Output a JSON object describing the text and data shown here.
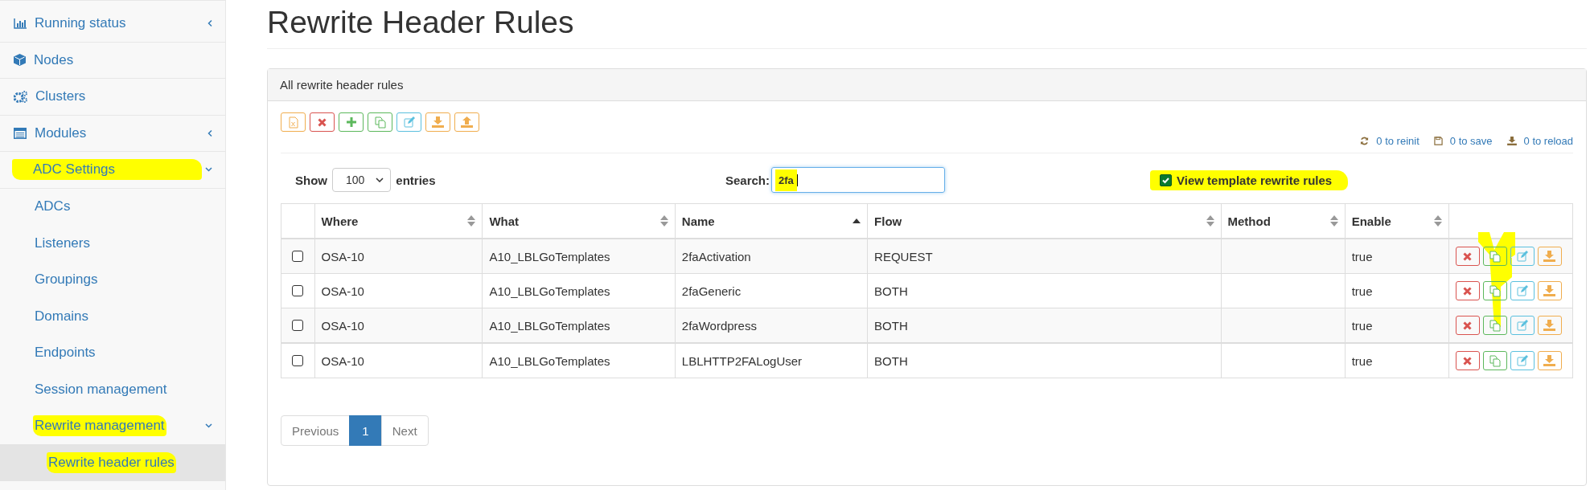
{
  "sidebar": {
    "items": [
      {
        "label": "Running status",
        "expanded": false,
        "highlighted": false,
        "selected": false
      },
      {
        "label": "Nodes",
        "highlighted": false,
        "selected": false
      },
      {
        "label": "Clusters",
        "highlighted": false,
        "selected": false
      },
      {
        "label": "Modules",
        "expanded": false,
        "highlighted": false,
        "selected": false
      },
      {
        "label": "ADC Settings",
        "expanded": true,
        "highlighted": true,
        "selected": false,
        "children": [
          {
            "label": "ADCs",
            "highlighted": false,
            "selected": false
          },
          {
            "label": "Listeners",
            "highlighted": false,
            "selected": false
          },
          {
            "label": "Groupings",
            "highlighted": false,
            "selected": false
          },
          {
            "label": "Domains",
            "highlighted": false,
            "selected": false
          },
          {
            "label": "Endpoints",
            "highlighted": false,
            "selected": false
          },
          {
            "label": "Session management",
            "highlighted": false,
            "selected": false
          },
          {
            "label": "Rewrite management",
            "expanded": true,
            "highlighted": true,
            "selected": false,
            "children": [
              {
                "label": "Rewrite header rules",
                "highlighted": true,
                "selected": true
              }
            ]
          }
        ]
      }
    ]
  },
  "page": {
    "title": "Rewrite Header Rules"
  },
  "panel": {
    "title": "All rewrite header rules",
    "toolbar": [
      {
        "kind": "excel"
      },
      {
        "kind": "delete"
      },
      {
        "kind": "add"
      },
      {
        "kind": "copy"
      },
      {
        "kind": "edit"
      },
      {
        "kind": "download"
      },
      {
        "kind": "upload"
      }
    ],
    "status_links": [
      {
        "kind": "reinit",
        "label": "0 to reinit"
      },
      {
        "kind": "save",
        "label": "0 to save"
      },
      {
        "kind": "reload",
        "label": "0 to reload"
      }
    ],
    "length": {
      "before": "Show",
      "value": "100",
      "after": "entries"
    },
    "search": {
      "label": "Search:",
      "value": "2fa",
      "highlighted": true
    },
    "template_toggle": {
      "label": "View template rewrite rules",
      "checked": true,
      "highlighted": true
    },
    "table": {
      "columns": [
        {
          "label": "Where",
          "sorted": false
        },
        {
          "label": "What",
          "sorted": false
        },
        {
          "label": "Name",
          "sorted": true
        },
        {
          "label": "Flow",
          "sorted": false
        },
        {
          "label": "Method",
          "sorted": false
        },
        {
          "label": "Enable",
          "sorted": false
        }
      ],
      "row_actions": [
        {
          "kind": "delete"
        },
        {
          "kind": "copy"
        },
        {
          "kind": "edit"
        },
        {
          "kind": "download"
        }
      ],
      "rows": [
        {
          "checked": false,
          "cells": [
            "OSA-10",
            "A10_LBLGoTemplates",
            "2faActivation",
            "REQUEST",
            "",
            "true"
          ]
        },
        {
          "checked": false,
          "cells": [
            "OSA-10",
            "A10_LBLGoTemplates",
            "2faGeneric",
            "BOTH",
            "",
            "true"
          ]
        },
        {
          "checked": false,
          "cells": [
            "OSA-10",
            "A10_LBLGoTemplates",
            "2faWordpress",
            "BOTH",
            "",
            "true"
          ]
        },
        {
          "checked": false,
          "cells": [
            "OSA-10",
            "A10_LBLGoTemplates",
            "LBLHTTP2FALogUser",
            "BOTH",
            "",
            "true"
          ]
        }
      ]
    },
    "pagination": {
      "previous": "Previous",
      "pages": [
        {
          "label": "1",
          "selected": true
        }
      ],
      "next": "Next"
    }
  }
}
